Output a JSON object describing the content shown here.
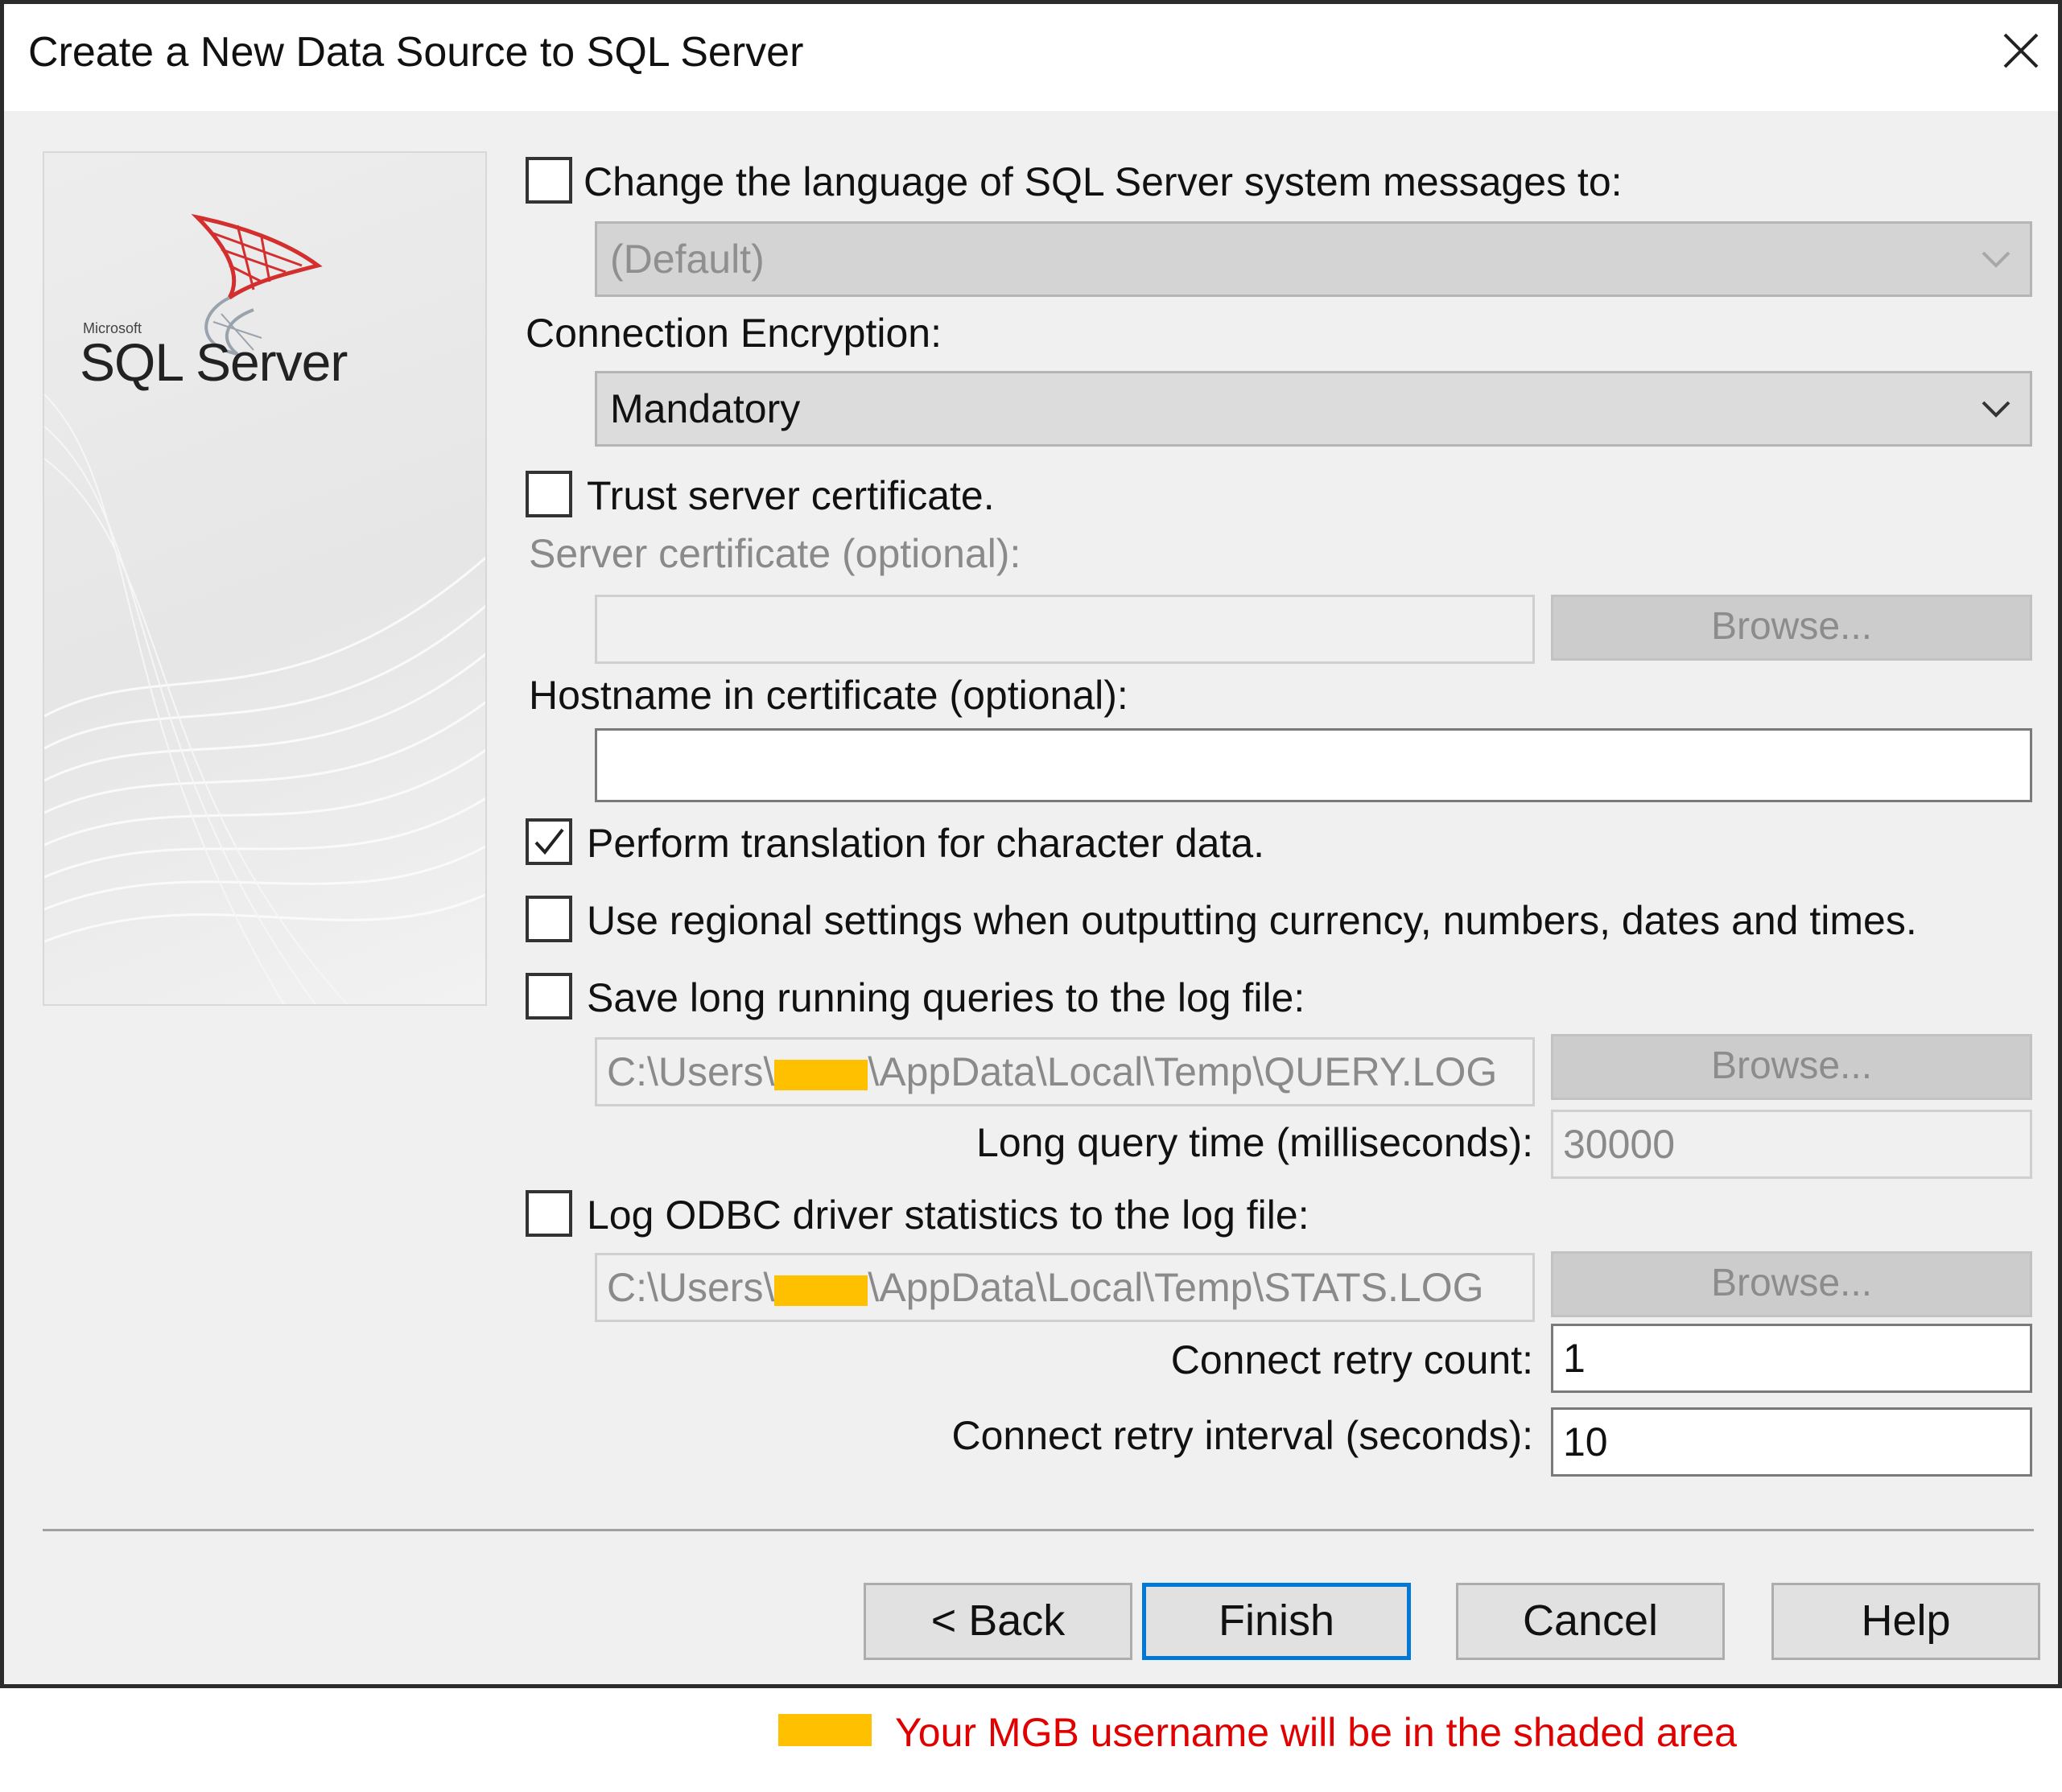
{
  "window": {
    "title": "Create a New Data Source to SQL Server"
  },
  "banner": {
    "logo_prefix": "Microsoft",
    "logo_text": "SQL Server"
  },
  "language": {
    "checkbox_label": "Change the language of SQL Server system messages to:",
    "checked": false,
    "selected": "(Default)"
  },
  "encryption": {
    "label": "Connection Encryption:",
    "selected": "Mandatory"
  },
  "trust_cert": {
    "checkbox_label": "Trust server certificate.",
    "checked": false
  },
  "server_cert": {
    "label": "Server certificate (optional):",
    "value": "",
    "browse_label": "Browse..."
  },
  "hostname": {
    "label": "Hostname in certificate (optional):",
    "value": ""
  },
  "translation": {
    "checkbox_label": "Perform translation for character data.",
    "checked": true
  },
  "regional": {
    "checkbox_label": "Use regional settings when outputting currency, numbers, dates and times.",
    "checked": false
  },
  "long_queries": {
    "checkbox_label": "Save long running queries to the log file:",
    "checked": false,
    "path_prefix": "C:\\Users\\",
    "path_suffix": "\\AppData\\Local\\Temp\\QUERY.LOG",
    "browse_label": "Browse...",
    "time_label": "Long query time (milliseconds):",
    "time_value": "30000"
  },
  "odbc_stats": {
    "checkbox_label": "Log ODBC driver statistics to the log file:",
    "checked": false,
    "path_prefix": "C:\\Users\\",
    "path_suffix": "\\AppData\\Local\\Temp\\STATS.LOG",
    "browse_label": "Browse..."
  },
  "retry": {
    "count_label": "Connect retry count:",
    "count_value": "1",
    "interval_label": "Connect retry interval (seconds):",
    "interval_value": "10"
  },
  "buttons": {
    "back": "< Back",
    "finish": "Finish",
    "cancel": "Cancel",
    "help": "Help"
  },
  "legend": {
    "text": "Your MGB username will be in the shaded area",
    "color": "#ffc000"
  },
  "icons": [
    "close-icon",
    "sql-server-logo",
    "chevron-down-icon",
    "checkmark-icon"
  ]
}
